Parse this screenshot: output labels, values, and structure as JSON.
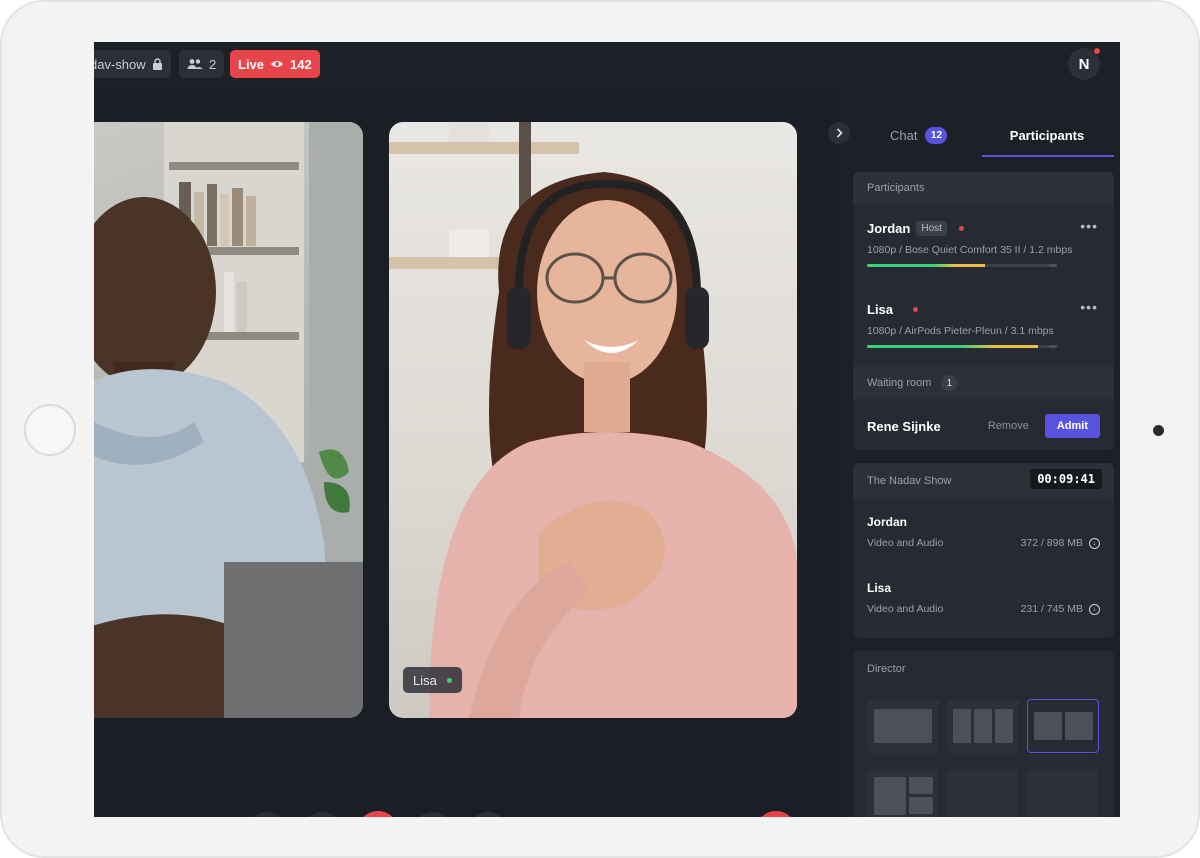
{
  "topbar": {
    "room_name": "dav-show",
    "participants_count": "2",
    "live_label": "Live",
    "viewers_count": "142",
    "avatar_initial": "N"
  },
  "stage": {
    "right_tile_name": "Lisa"
  },
  "controls": [
    "share-screen",
    "microphone",
    "record",
    "volume",
    "camera",
    "hang-up"
  ],
  "sidebar": {
    "tabs": {
      "chat_label": "Chat",
      "chat_badge": "12",
      "participants_label": "Participants"
    },
    "participants_card": {
      "title": "Participants",
      "people": [
        {
          "name": "Jordan",
          "role": "Host",
          "detail": "1080p / Bose Quiet Comfort 35 II / 1.2 mbps",
          "level": 0.62
        },
        {
          "name": "Lisa",
          "role": "",
          "detail": "1080p / AirPods Pieter-Pleun / 3.1 mbps",
          "level": 0.9
        }
      ],
      "waiting_room_label": "Waiting room",
      "waiting_count": "1",
      "waiting_person": "Rene Sijnke",
      "remove_label": "Remove",
      "admit_label": "Admit"
    },
    "recording_card": {
      "title": "The Nadav Show",
      "timer": "00:09:41",
      "recordings": [
        {
          "name": "Jordan",
          "type": "Video and Audio",
          "size": "372 / 898 MB"
        },
        {
          "name": "Lisa",
          "type": "Video and Audio",
          "size": "231 / 745 MB"
        }
      ]
    },
    "director_card": {
      "title": "Director"
    }
  },
  "colors": {
    "accent": "#5a52e0",
    "live_red": "#e8454a",
    "background": "#1d2027",
    "panel": "#262a33"
  }
}
